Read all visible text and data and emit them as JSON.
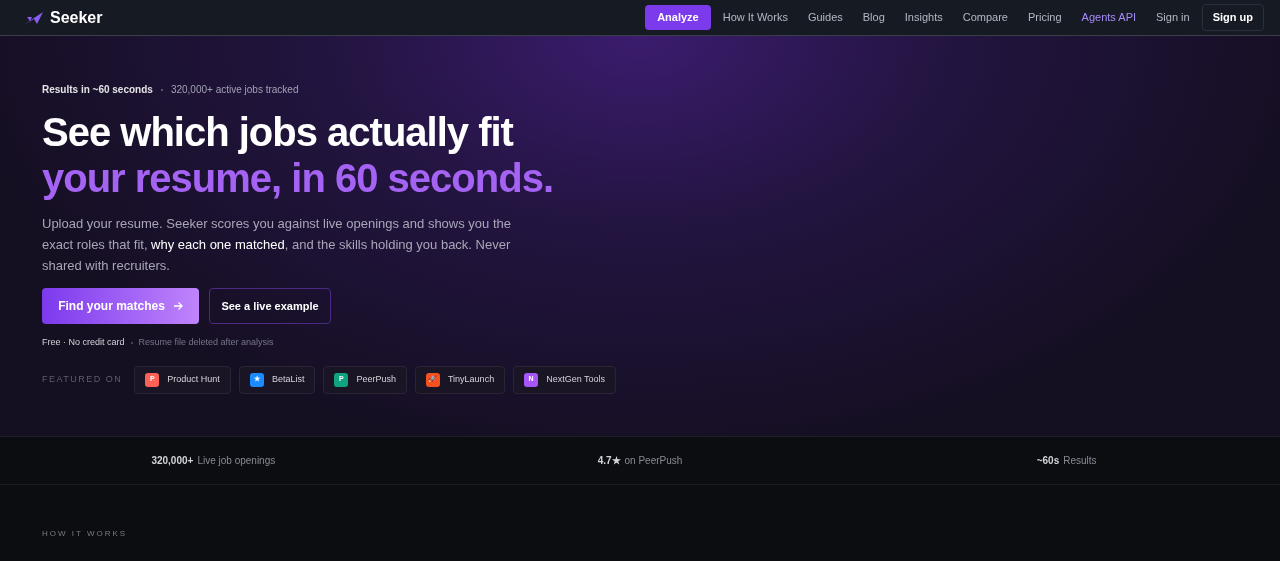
{
  "brand": {
    "name": "Seeker"
  },
  "nav": [
    {
      "label": "Analyze",
      "kind": "primary"
    },
    {
      "label": "How It Works",
      "kind": "link"
    },
    {
      "label": "Guides",
      "kind": "link"
    },
    {
      "label": "Blog",
      "kind": "link"
    },
    {
      "label": "Insights",
      "kind": "link"
    },
    {
      "label": "Compare",
      "kind": "link"
    },
    {
      "label": "Pricing",
      "kind": "link"
    },
    {
      "label": "Agents API",
      "kind": "accent"
    },
    {
      "label": "Sign in",
      "kind": "link"
    },
    {
      "label": "Sign up",
      "kind": "outline"
    }
  ],
  "hero": {
    "eyebrow": "Results in ~60 seconds",
    "eyebrow_note": "320,000+ active jobs tracked",
    "title": "See which jobs actually fit",
    "title_accent": "your resume, in 60 seconds.",
    "description": "Upload your resume. Seeker scores you against live openings and shows you the exact roles that fit, **why each one matched**, and the skills holding you back. Never shared with recruiters.",
    "primary_button": "Find your matches",
    "secondary_button": "See a live example",
    "note": "Free · No credit card",
    "note_secondary": "Resume file deleted after analysis",
    "featured_label": "FEATURED ON",
    "featured": [
      {
        "name": "Product Hunt",
        "letter": "P",
        "color": "#ff6154"
      },
      {
        "name": "BetaList",
        "letter": "★",
        "color": "#1a8cff"
      },
      {
        "name": "PeerPush",
        "letter": "P",
        "color": "#10a37f"
      },
      {
        "name": "TinyLaunch",
        "letter": "🚀",
        "color": "#f4511e"
      },
      {
        "name": "NextGen Tools",
        "letter": "N",
        "color": "#a855f7"
      }
    ]
  },
  "stats": [
    {
      "value": "320,000+",
      "label": "Live job openings"
    },
    {
      "value": "4.7★",
      "label": "on PeerPush"
    },
    {
      "value": "~60s",
      "label": "Results"
    }
  ],
  "how_it_works": {
    "label": "HOW IT WORKS"
  }
}
